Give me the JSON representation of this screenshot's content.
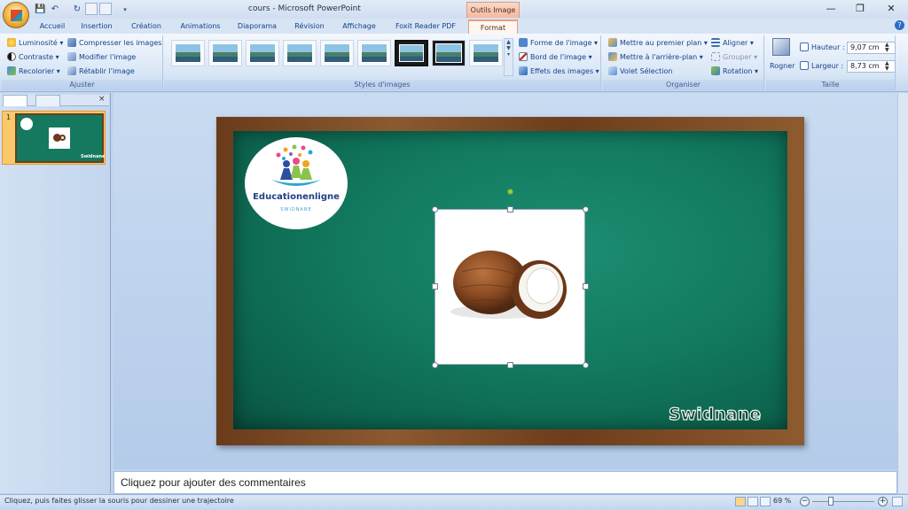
{
  "window": {
    "title": "cours - Microsoft PowerPoint",
    "contextual_tab_group": "Outils Image",
    "controls": {
      "minimize": "—",
      "restore": "❐",
      "close": "✕"
    }
  },
  "qat": {
    "save": "💾",
    "undo": "↶",
    "redo": "↻"
  },
  "tabs": [
    "Accueil",
    "Insertion",
    "Création",
    "Animations",
    "Diaporama",
    "Révision",
    "Affichage",
    "Foxit Reader PDF",
    "Format"
  ],
  "active_tab": "Format",
  "ribbon": {
    "ajuster": {
      "label": "Ajuster",
      "luminosite": "Luminosité",
      "contraste": "Contraste",
      "recolorier": "Recolorier",
      "compresser": "Compresser les images",
      "modifier": "Modifier l'image",
      "retablir": "Rétablir l'image"
    },
    "styles": {
      "label": "Styles d'images",
      "forme": "Forme de l'image",
      "bord": "Bord de l'image",
      "effets": "Effets des images"
    },
    "organiser": {
      "label": "Organiser",
      "premier_plan": "Mettre au premier plan",
      "arriere_plan": "Mettre à l'arrière-plan",
      "volet": "Volet Sélection",
      "aligner": "Aligner",
      "grouper": "Grouper",
      "rotation": "Rotation"
    },
    "taille": {
      "label": "Taille",
      "rogner": "Rogner",
      "hauteur_label": "Hauteur :",
      "hauteur_value": "9,07 cm",
      "largeur_label": "Largeur :",
      "largeur_value": "8,73 cm"
    }
  },
  "slides_pane": {
    "slide_number": "1",
    "thumb_watermark": "Swidnane"
  },
  "slide": {
    "logo_title": "Educationenligne",
    "logo_subtitle": "SWIDNANE",
    "watermark": "Swidnane"
  },
  "notes_placeholder": "Cliquez pour ajouter des commentaires",
  "status": {
    "text": "Cliquez, puis faites glisser la souris pour dessiner une trajectoire",
    "zoom": "69 %"
  }
}
